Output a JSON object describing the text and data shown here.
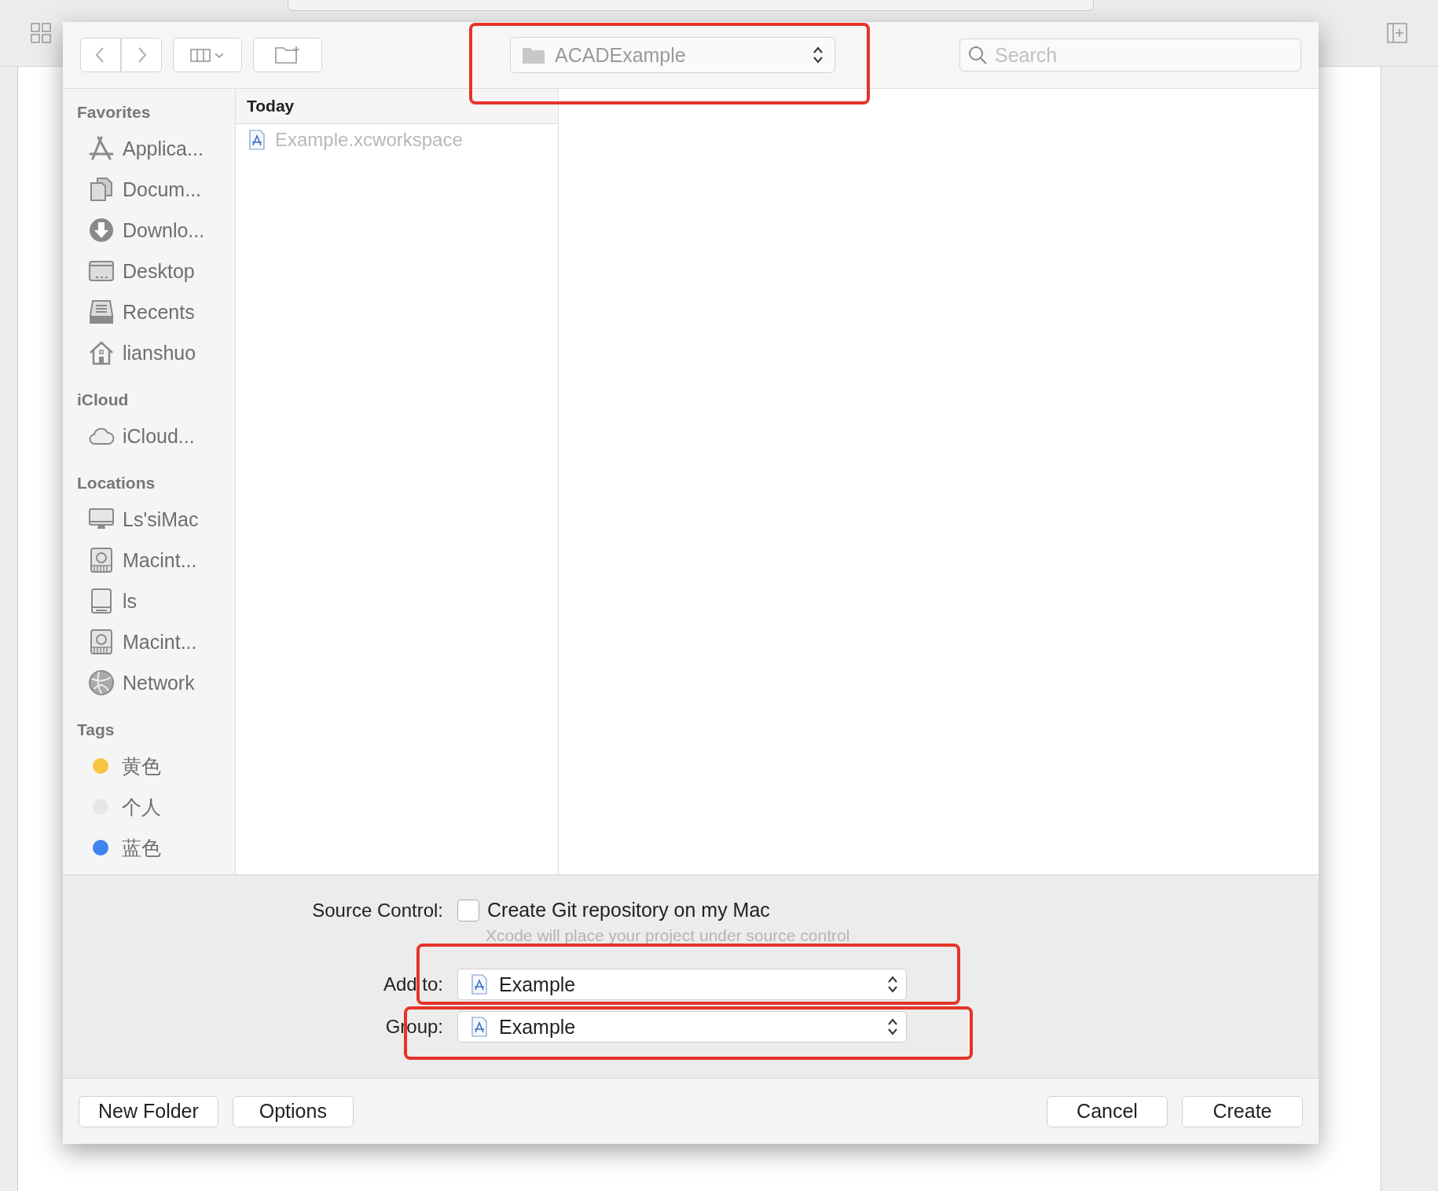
{
  "toolbar": {
    "location": {
      "label": "ACADExample",
      "highlighted": true
    },
    "search": {
      "placeholder": "Search"
    }
  },
  "sidebar": {
    "sections": [
      {
        "title": "Favorites",
        "items": [
          {
            "label": "Applica...",
            "kind": "apps"
          },
          {
            "label": "Docum...",
            "kind": "documents"
          },
          {
            "label": "Downlo...",
            "kind": "downloads"
          },
          {
            "label": "Desktop",
            "kind": "desktop"
          },
          {
            "label": "Recents",
            "kind": "recents"
          },
          {
            "label": "lianshuo",
            "kind": "home"
          }
        ]
      },
      {
        "title": "iCloud",
        "items": [
          {
            "label": "iCloud...",
            "kind": "cloud"
          }
        ]
      },
      {
        "title": "Locations",
        "items": [
          {
            "label": "Ls'siMac",
            "kind": "computer"
          },
          {
            "label": "Macint...",
            "kind": "disk"
          },
          {
            "label": "ls",
            "kind": "drive"
          },
          {
            "label": "Macint...",
            "kind": "disk"
          },
          {
            "label": "Network",
            "kind": "network"
          }
        ]
      },
      {
        "title": "Tags",
        "items": [
          {
            "label": "黄色",
            "kind": "tag",
            "color": "#f5c542"
          },
          {
            "label": "个人",
            "kind": "tag",
            "color": "#e6e6e6"
          },
          {
            "label": "蓝色",
            "kind": "tag",
            "color": "#3f84f0"
          }
        ]
      }
    ]
  },
  "browser": {
    "header": "Today",
    "files": [
      {
        "name": "Example.xcworkspace",
        "disabled": true
      }
    ]
  },
  "options": {
    "source_control": {
      "label": "Source Control:",
      "checkbox_label": "Create Git repository on my Mac",
      "checked": false,
      "hint": "Xcode will place your project under source control"
    },
    "add_to": {
      "label": "Add to:",
      "value": "Example",
      "highlighted": true
    },
    "group": {
      "label": "Group:",
      "value": "Example",
      "highlighted": true
    }
  },
  "buttons_left": [
    "New Folder",
    "Options"
  ],
  "buttons_right": [
    "Cancel",
    "Create"
  ]
}
